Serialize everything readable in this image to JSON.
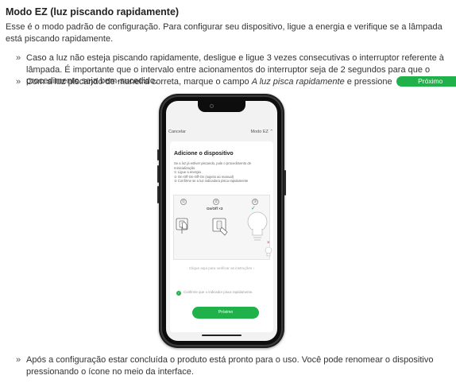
{
  "title": "Modo EZ (luz piscando rapidamente)",
  "intro": "Esse é o modo padrão de configuração. Para configurar seu dispositivo, ligue a energia e verifique se a lâmpada está piscando rapidamente.",
  "bullet_mark": "»",
  "bullet1": "Caso a luz não esteja piscando rapidamente, desligue e ligue 3 vezes consecutivas o interruptor referente à lâmpada. É importante que o intervalo entre acionamentos do interruptor seja de 2 segundos para que o procedimento seja bem-sucedido.",
  "bullet2": {
    "before": "Com a luz piscando de maneira correta, marque o campo ",
    "emph": "A luz pisca rapidamente",
    "after": " e pressione ",
    "button": "Próximo",
    "end": "."
  },
  "bullet3": "Após a configuração estar concluída o produto está pronto para o uso. Você pode renomear o dispositivo pressionando o ícone no meio da interface.",
  "phone": {
    "cancel": "Cancelar",
    "mode": "Modo EZ",
    "mode_arrow": "⌃",
    "card_title": "Adicione o dispositivo",
    "desc": [
      "Se a luz já estiver piscando, pule o procedimento de",
      "reinicialização",
      "① Ligue a energia",
      "② On-Off-On-Off-On (sujeito ao manual)",
      "③ Confirme se a luz indicadora pisca rapidamente"
    ],
    "steps": [
      "①",
      "②",
      "③"
    ],
    "onoff_label": "On/Off ×3",
    "check": "✓",
    "x": "×",
    "help_link": "Clique aqui para verificar as instruções ›",
    "confirm_check": "✓",
    "confirm_text": "Confirme que o indicador pisca rapidamente.",
    "next_button": "Próximo"
  },
  "colors": {
    "accent": "#21b14b",
    "error": "#d03030"
  }
}
